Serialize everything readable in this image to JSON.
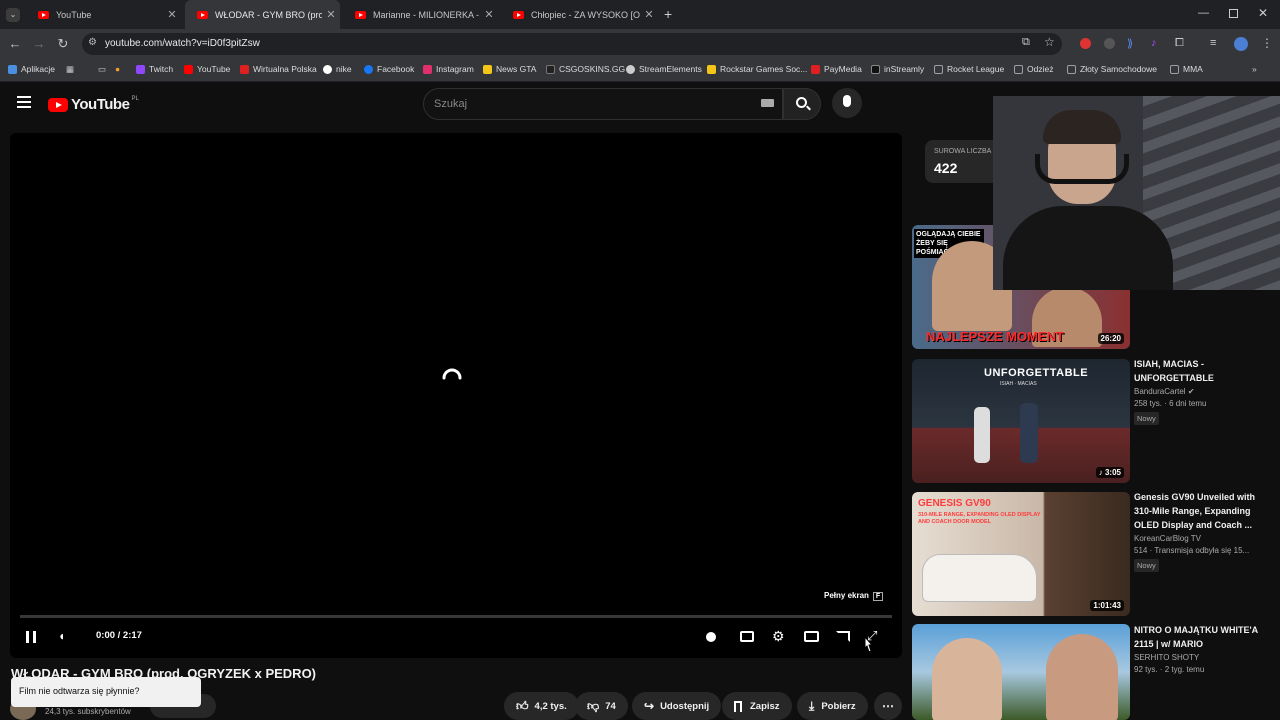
{
  "browser": {
    "tabs": [
      {
        "title": "YouTube"
      },
      {
        "title": "WŁODAR - GYM BRO (prod. OGRYZEK x PEDRO)"
      },
      {
        "title": "Marianne - MILIONERKA - YouTube"
      },
      {
        "title": "Chłopiec - ZA WYSOKO [Official Video]"
      }
    ],
    "url": "youtube.com/watch?v=iD0f3pitZsw",
    "bookmarks": [
      {
        "label": "Aplikacje",
        "color": "#4a90e2"
      },
      {
        "label": "Twitch",
        "color": "#9146ff"
      },
      {
        "label": "YouTube",
        "color": "#ff0000"
      },
      {
        "label": "Wirtualna Polska",
        "color": "#e02020"
      },
      {
        "label": "nike",
        "color": "#ffffff"
      },
      {
        "label": "Facebook",
        "color": "#1877f2"
      },
      {
        "label": "Instagram",
        "color": "#e1306c"
      },
      {
        "label": "News GTA",
        "color": "#f5c518"
      },
      {
        "label": "CSGOSKINS.GG",
        "color": "#222222"
      },
      {
        "label": "StreamElements",
        "color": "#cccccc"
      },
      {
        "label": "Rockstar Games Soc...",
        "color": "#f5c518"
      },
      {
        "label": "PayMedia",
        "color": "#e02020"
      },
      {
        "label": "inStreamly",
        "color": "#111111"
      },
      {
        "label": "Rocket League",
        "color": "#9aa0a6"
      },
      {
        "label": "Odzież",
        "color": "#9aa0a6"
      },
      {
        "label": "Złoty Samochodowe",
        "color": "#9aa0a6"
      },
      {
        "label": "MMA",
        "color": "#9aa0a6"
      }
    ]
  },
  "youtube": {
    "logo_text": "YouTube",
    "logo_region": "PL",
    "search_placeholder": "Szukaj"
  },
  "player": {
    "time": "0:00 / 2:17",
    "progress": 0,
    "fullscreen_tooltip": "Pełny ekran",
    "fullscreen_key": "F"
  },
  "video": {
    "title": "WŁODAR - GYM BRO (prod. OGRYZEK x PEDRO)",
    "subscribers": "24,3 tys. subskrybentów",
    "toast": "Film nie odtwarza się płynnie?",
    "likes": "4,2 tys.",
    "dislikes": "74",
    "share": "Udostępnij",
    "save": "Zapisz",
    "download": "Pobierz"
  },
  "live_counter": {
    "label": "SUROWA LICZBA",
    "value": "422"
  },
  "recommendations": [
    {
      "thumb_text": "OGLĄDAJĄ CIEBIE ŻEBY SIĘ POŚMIAĆ",
      "thumb_caption": "NAJLEPSZE MOMENT",
      "duration": "26:20",
      "colors": [
        "#4a6b8a",
        "#8a3030"
      ]
    },
    {
      "title": "ISIAH, MACIAS - UNFORGETTABLE",
      "channel": "BanduraCartel",
      "views": "258 tys.",
      "age": "6 dni temu",
      "badge": "Nowy",
      "thumb_text": "UNFORGETTABLE",
      "thumb_sub": "ISIAH · MACIAS",
      "duration": "3:05",
      "colors": [
        "#2b3540",
        "#6b2a2a"
      ]
    },
    {
      "title": "Genesis GV90 Unveiled with 310-Mile Range, Expanding OLED  Display and Coach ...",
      "channel": "KoreanCarBlog TV",
      "views": "514",
      "age": "Transmisja odbyła się 15...",
      "badge": "Nowy",
      "thumb_text": "GENESIS GV90",
      "thumb_sub": "310-MILE RANGE, EXPANDING OLED DISPLAY AND COACH DOOR MODEL",
      "duration": "1:01:43",
      "colors": [
        "#c9b8a8",
        "#5a4030"
      ]
    },
    {
      "title": "NITRO O MAJĄTKU WHITE'A 2115 | w/ MARIO",
      "channel": "SERHITO SHOTY",
      "views": "92 tys.",
      "age": "2 tyg. temu",
      "colors": [
        "#5aa0d8",
        "#3c5a28"
      ]
    }
  ]
}
